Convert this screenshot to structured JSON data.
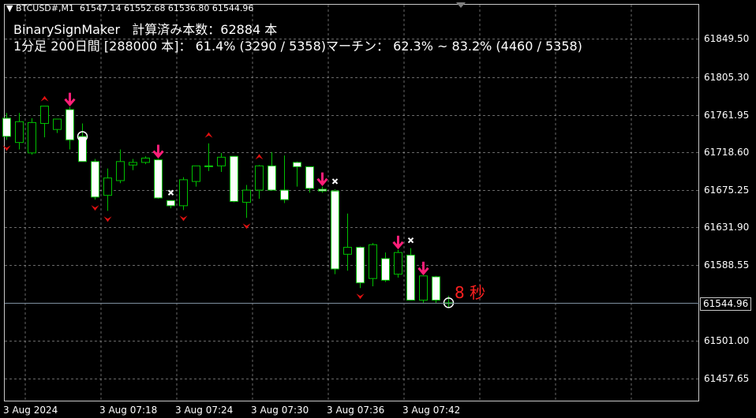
{
  "header": {
    "symbol_line": "BTCUSD#,M1  61547.14 61552.68 61536.80 61544.96"
  },
  "indicator": {
    "line1": "BinarySignMaker   計算済み本数：62884 本",
    "line2": "1分足 200日間 [288000 本]： 61.4% (3290 / 5358)マーチン： 62.3% ~ 83.2% (4460 / 5358)"
  },
  "timer": {
    "text": "8 秒"
  },
  "colors": {
    "background": "#000000",
    "grid": "#c0c0c0",
    "bull_body": "#000000",
    "bear_body": "#ffffff",
    "wick": "#00c000",
    "signal_arrow": "#ff1e78",
    "small_arrow": "#e01010",
    "cross": "#ffffff",
    "price_line": "#7f8fa0"
  },
  "chart_data": {
    "type": "candlestick",
    "symbol": "BTCUSD#",
    "timeframe": "M1",
    "current_price": "61544.96",
    "y_ticks": [
      "61849.50",
      "61805.30",
      "61761.95",
      "61718.60",
      "61675.25",
      "61631.90",
      "61588.55",
      "61544.96",
      "61501.00",
      "61457.65"
    ],
    "y_tick_values": [
      61849.5,
      61805.3,
      61761.95,
      61718.6,
      61675.25,
      61631.9,
      61588.55,
      61544.96,
      61501.0,
      61457.65
    ],
    "x_ticks": [
      "3 Aug 2024",
      "3 Aug 07:18",
      "3 Aug 07:24",
      "3 Aug 07:30",
      "3 Aug 07:36",
      "3 Aug 07:42"
    ],
    "ylim": [
      61432,
      61889
    ],
    "candles": [
      {
        "o": 61758,
        "h": 61764,
        "c": 61737,
        "l": 61733
      },
      {
        "o": 61730,
        "h": 61764,
        "c": 61754,
        "l": 61722
      },
      {
        "o": 61718,
        "h": 61758,
        "c": 61753,
        "l": 61716
      },
      {
        "o": 61752,
        "h": 61771,
        "c": 61772,
        "l": 61736
      },
      {
        "o": 61745,
        "h": 61757,
        "c": 61757,
        "l": 61741
      },
      {
        "o": 61768,
        "h": 61771,
        "c": 61733,
        "l": 61722
      },
      {
        "o": 61737,
        "h": 61752,
        "c": 61708,
        "l": 61708
      },
      {
        "o": 61708,
        "h": 61711,
        "c": 61667,
        "l": 61664
      },
      {
        "o": 61669,
        "h": 61700,
        "c": 61689,
        "l": 61651
      },
      {
        "o": 61686,
        "h": 61722,
        "c": 61708,
        "l": 61683
      },
      {
        "o": 61704,
        "h": 61711,
        "c": 61707,
        "l": 61698
      },
      {
        "o": 61707,
        "h": 61714,
        "c": 61712,
        "l": 61705
      },
      {
        "o": 61710,
        "h": 61711,
        "c": 61666,
        "l": 61665
      },
      {
        "o": 61663,
        "h": 61663,
        "c": 61657,
        "l": 61654
      },
      {
        "o": 61657,
        "h": 61690,
        "c": 61687,
        "l": 61652
      },
      {
        "o": 61685,
        "h": 61703,
        "c": 61703,
        "l": 61679
      },
      {
        "o": 61703,
        "h": 61729,
        "c": 61702,
        "l": 61697
      },
      {
        "o": 61703,
        "h": 61718,
        "c": 61713,
        "l": 61696
      },
      {
        "o": 61714,
        "h": 61714,
        "c": 61662,
        "l": 61661
      },
      {
        "o": 61661,
        "h": 61681,
        "c": 61675,
        "l": 61643
      },
      {
        "o": 61675,
        "h": 61704,
        "c": 61703,
        "l": 61665
      },
      {
        "o": 61703,
        "h": 61719,
        "c": 61675,
        "l": 61675
      },
      {
        "o": 61675,
        "h": 61715,
        "c": 61664,
        "l": 61660
      },
      {
        "o": 61707,
        "h": 61708,
        "c": 61702,
        "l": 61679
      },
      {
        "o": 61702,
        "h": 61702,
        "c": 61677,
        "l": 61672
      },
      {
        "o": 61676,
        "h": 61679,
        "c": 61674,
        "l": 61672
      },
      {
        "o": 61674,
        "h": 61676,
        "c": 61584,
        "l": 61578
      },
      {
        "o": 61601,
        "h": 61648,
        "c": 61609,
        "l": 61582
      },
      {
        "o": 61609,
        "h": 61610,
        "c": 61568,
        "l": 61562
      },
      {
        "o": 61573,
        "h": 61614,
        "c": 61612,
        "l": 61564
      },
      {
        "o": 61596,
        "h": 61603,
        "c": 61571,
        "l": 61569
      },
      {
        "o": 61578,
        "h": 61606,
        "c": 61603,
        "l": 61574
      },
      {
        "o": 61600,
        "h": 61608,
        "c": 61548,
        "l": 61548
      },
      {
        "o": 61548,
        "h": 61576,
        "c": 61576,
        "l": 61545
      },
      {
        "o": 61575,
        "h": 61576,
        "c": 61548,
        "l": 61544
      },
      {
        "o": 61545,
        "h": 61553,
        "c": 61545,
        "l": 61539
      }
    ],
    "signals": [
      {
        "i": -1,
        "t": "up_small"
      },
      {
        "i": 0,
        "t": "down_small"
      },
      {
        "i": 3,
        "t": "up_small"
      },
      {
        "i": 5,
        "t": "down_arrow"
      },
      {
        "i": 6,
        "t": "circle"
      },
      {
        "i": 7,
        "t": "down_small"
      },
      {
        "i": 8,
        "t": "down_small"
      },
      {
        "i": 12,
        "t": "down_arrow"
      },
      {
        "i": 13,
        "t": "cross"
      },
      {
        "i": 14,
        "t": "down_small"
      },
      {
        "i": 16,
        "t": "up_small"
      },
      {
        "i": 19,
        "t": "down_small"
      },
      {
        "i": 20,
        "t": "up_small"
      },
      {
        "i": 25,
        "t": "down_arrow"
      },
      {
        "i": 26,
        "t": "cross"
      },
      {
        "i": 28,
        "t": "down_small"
      },
      {
        "i": 31,
        "t": "down_arrow"
      },
      {
        "i": 32,
        "t": "cross"
      },
      {
        "i": 33,
        "t": "down_arrow"
      },
      {
        "i": 35,
        "t": "circle"
      }
    ]
  }
}
